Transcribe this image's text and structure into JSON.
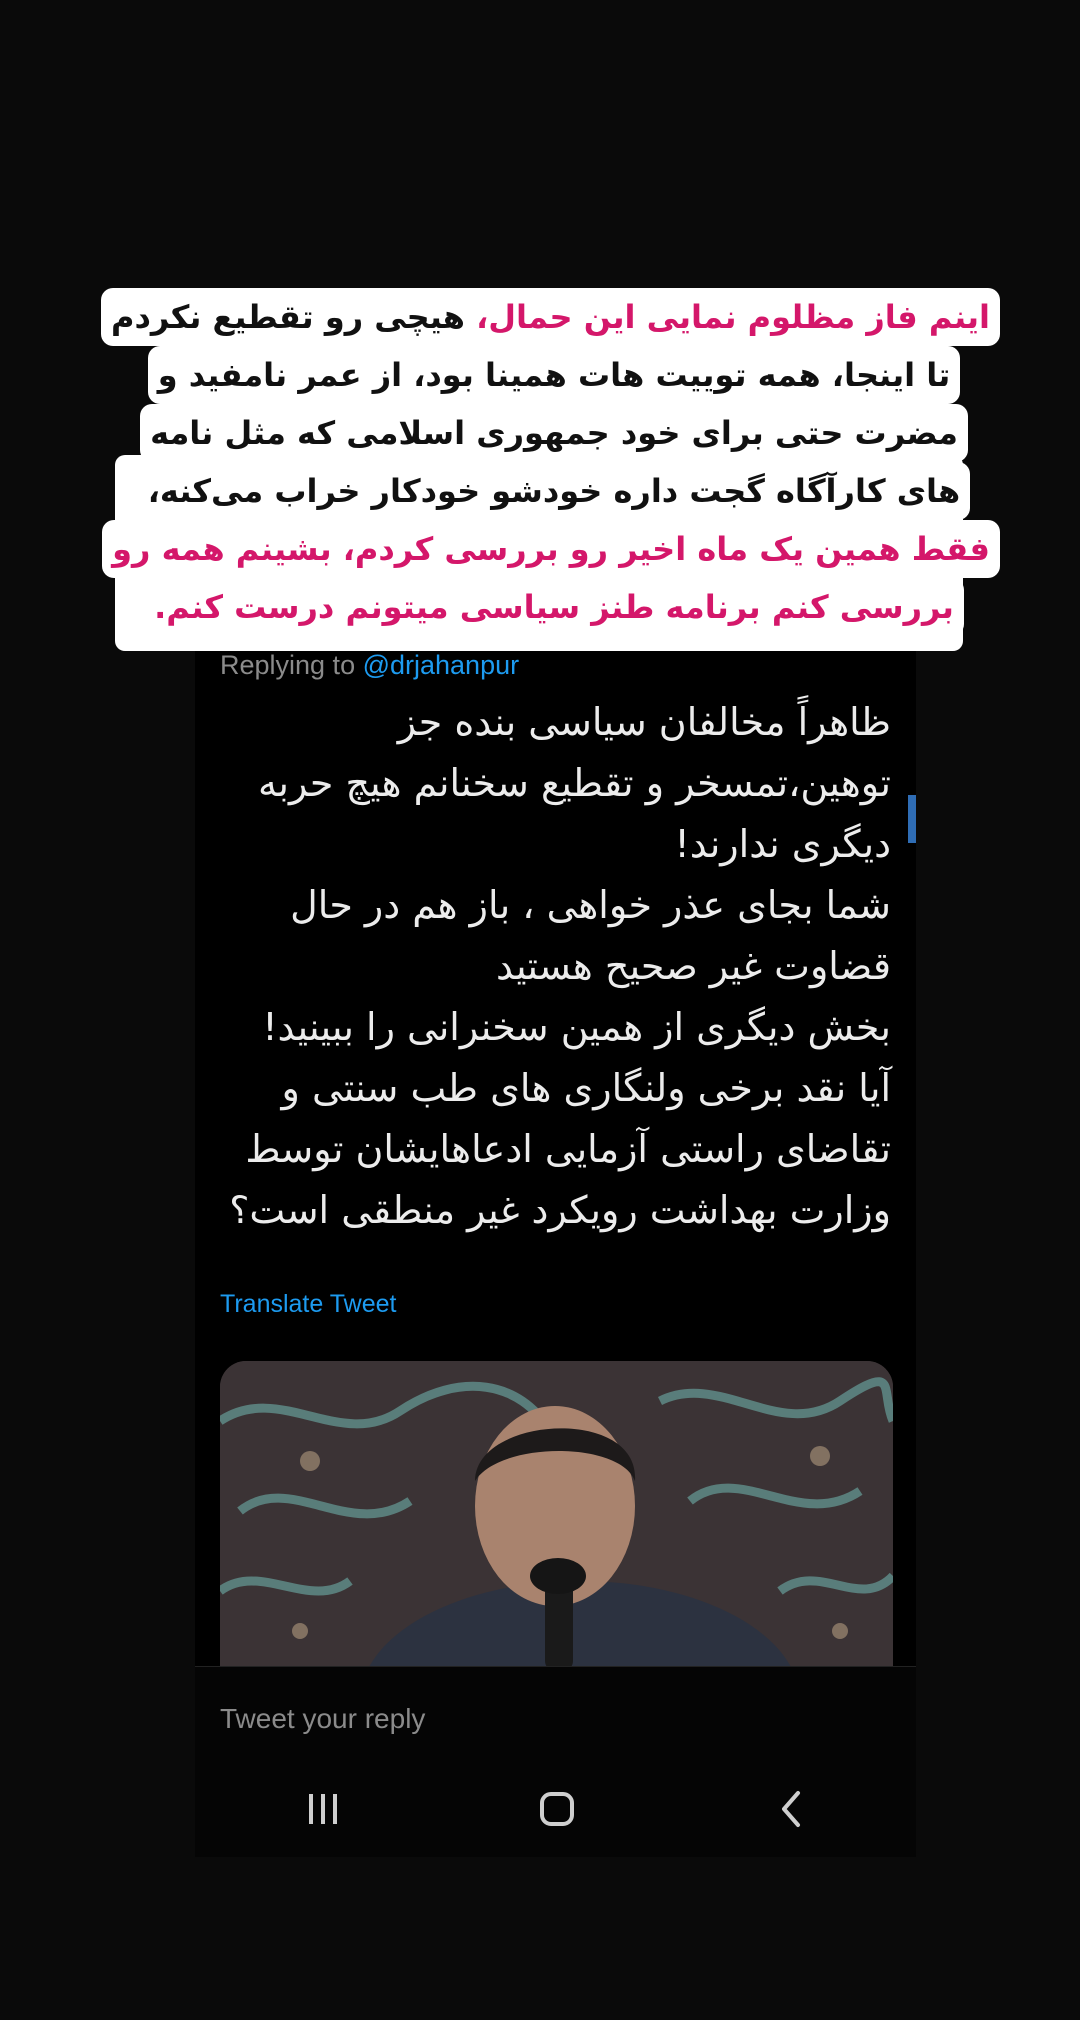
{
  "caption": {
    "line1_pink": "اینم فاز مظلوم نمایی این حمال،",
    "line1_black": " هیچی رو تقطیع نکردم",
    "line2": "تا اینجا، همه توییت هات همینا بود، از عمر نامفید و",
    "line3": "مضرت حتی برای خود جمهوری اسلامی که مثل نامه",
    "line4": "های کارآگاه گجت داره خودشو خودکار خراب می‌کنه،",
    "line5": "فقط همین یک ماه اخیر رو بررسی کردم، بشینم همه رو",
    "line6": "بررسی کنم برنامه طنز سیاسی میتونم درست کنم."
  },
  "tweet": {
    "replying_prefix": "Replying to ",
    "replying_handle": "@drjahanpur",
    "lines": [
      "ظاهراً مخالفان سیاسی بنده جز",
      "توهین،تمسخر و تقطیع سخنانم هیچ حربه",
      "دیگری ندارند!",
      "شما بجای عذر خواهی ، باز هم در حال",
      "قضاوت غیر صحیح هستید",
      "بخش دیگری از همین سخنرانی را ببینید!",
      "آیا نقد برخی ولنگاری های طب سنتی و",
      "تقاضای راستی آزمایی ادعاهایشان توسط",
      "وزارت بهداشت رویکرد غیر منطقی است؟"
    ],
    "translate_label": "Translate Tweet",
    "media_icon": "video-thumbnail-icon"
  },
  "reply": {
    "placeholder": "Tweet your reply"
  },
  "navbar": {
    "recents_icon": "recents-icon",
    "home_icon": "home-icon",
    "back_icon": "back-icon"
  },
  "colors": {
    "pink": "#d4176a",
    "link": "#1d9bf0",
    "muted": "#8b8b8b"
  }
}
